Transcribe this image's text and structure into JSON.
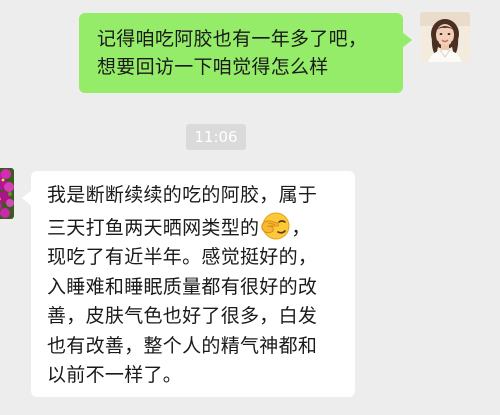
{
  "chat": {
    "outgoing_message": {
      "lines": [
        "记得咱吃阿胶也有一年多了吧，",
        "想要回访一下咱觉得怎么样"
      ]
    },
    "timestamp": "11:06",
    "incoming_message": {
      "lines": [
        "我是断断续续的吃的阿胶，属于",
        "三天打鱼两天晒网类型的",
        "，",
        "现吃了有近半年。感觉挺好的，",
        "入睡难和睡眠质量都有很好的改",
        "善，皮肤气色也好了很多，白发",
        "也有改善，整个人的精气神都和",
        "以前不一样了。"
      ],
      "emoji": "facepalm-emoji"
    },
    "colors": {
      "background": "#ededed",
      "outgoing_bubble": "#95ec69",
      "incoming_bubble": "#ffffff",
      "timestamp_bg": "#dadada",
      "text": "#1a1a1a"
    }
  }
}
